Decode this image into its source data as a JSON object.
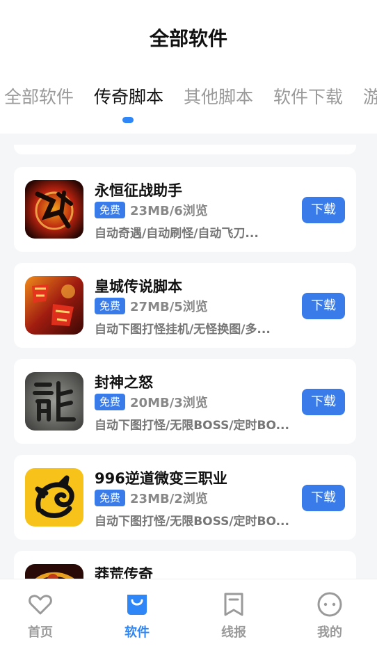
{
  "header": {
    "title": "全部软件"
  },
  "tabs": [
    {
      "label": "全部软件"
    },
    {
      "label": "传奇脚本"
    },
    {
      "label": "其他脚本"
    },
    {
      "label": "软件下载"
    },
    {
      "label": "游"
    }
  ],
  "active_tab": "传奇脚本",
  "apps": [
    {
      "name": "永恒征战助手",
      "badge": "免费",
      "meta": "23MB/6浏览",
      "desc": "自动奇遇/自动刷怪/自动飞刀...",
      "button": "下载",
      "icon": "zhengzhan-game-icon"
    },
    {
      "name": "皇城传说脚本",
      "badge": "免费",
      "meta": "27MB/5浏览",
      "desc": "自动下图打怪挂机/无怪换图/多...",
      "button": "下载",
      "icon": "huangcheng-game-icon"
    },
    {
      "name": "封神之怒",
      "badge": "免费",
      "meta": "20MB/3浏览",
      "desc": "自动下图打怪/无限BOSS/定时BO...",
      "button": "下载",
      "icon": "long-stone-icon"
    },
    {
      "name": "996逆道微变三职业",
      "badge": "免费",
      "meta": "23MB/2浏览",
      "desc": "自动下图打怪/无限BOSS/定时BO...",
      "button": "下载",
      "icon": "black-dragon-icon"
    },
    {
      "name": "莽荒传奇",
      "badge": "",
      "meta": "",
      "desc": "",
      "button": "",
      "icon": "golden-dragon-icon"
    }
  ],
  "tabbar": {
    "items": [
      {
        "label": "首页",
        "icon": "heart-icon"
      },
      {
        "label": "软件",
        "icon": "bag-icon"
      },
      {
        "label": "线报",
        "icon": "bookmark-icon"
      },
      {
        "label": "我的",
        "icon": "face-icon"
      }
    ],
    "active": "软件"
  },
  "colors": {
    "accent": "#2f86f6",
    "badge": "#3a7bea",
    "background": "#f5f6f7"
  }
}
